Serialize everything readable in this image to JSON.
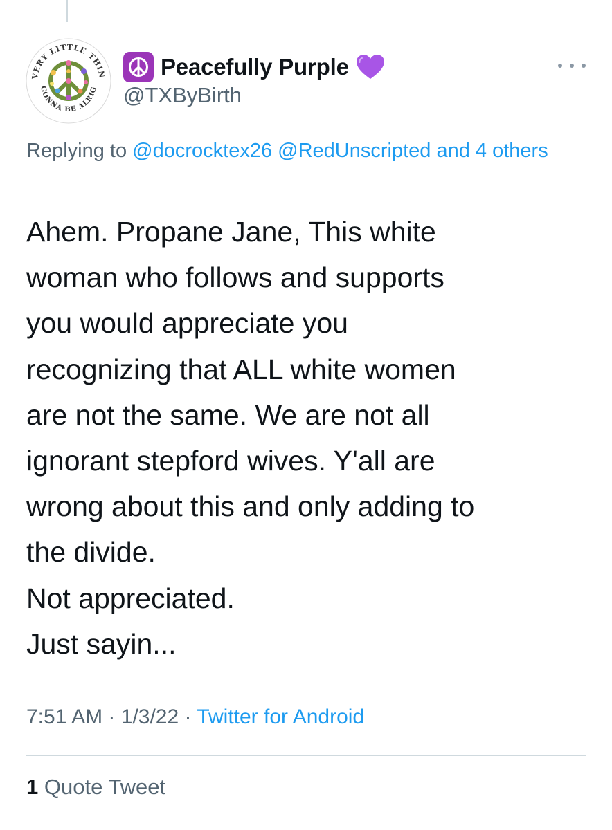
{
  "tweet": {
    "display_name": "Peacefully Purple",
    "name_prefix_icon": "peace-symbol-icon",
    "name_suffix_icon": "purple-heart-icon",
    "handle": "@TXByBirth",
    "avatar_text": "EVERY LITTLE THING IS GONNA BE ALRIGHT",
    "replying_prefix": "Replying to",
    "mentions": [
      "@docrocktex26",
      "@RedUnscripted"
    ],
    "replying_suffix": "and 4 others",
    "text": "Ahem. Propane Jane, This white\nwoman who follows and supports\nyou would appreciate you\nrecognizing that ALL white women\nare not the same. We are not all\nignorant stepford wives. Y'all are\nwrong about this and only adding to\nthe divide.\nNot appreciated.\nJust sayin...",
    "time": "7:51 AM",
    "date": "1/3/22",
    "source": "Twitter for Android",
    "separator": "·"
  },
  "stats": {
    "quote_count": "1",
    "quote_label": "Quote Tweet"
  },
  "colors": {
    "text": "#0f1419",
    "secondary": "#536471",
    "link": "#1d9bf0",
    "badge_purple": "#9b35b8",
    "divider": "#cfd9de"
  }
}
